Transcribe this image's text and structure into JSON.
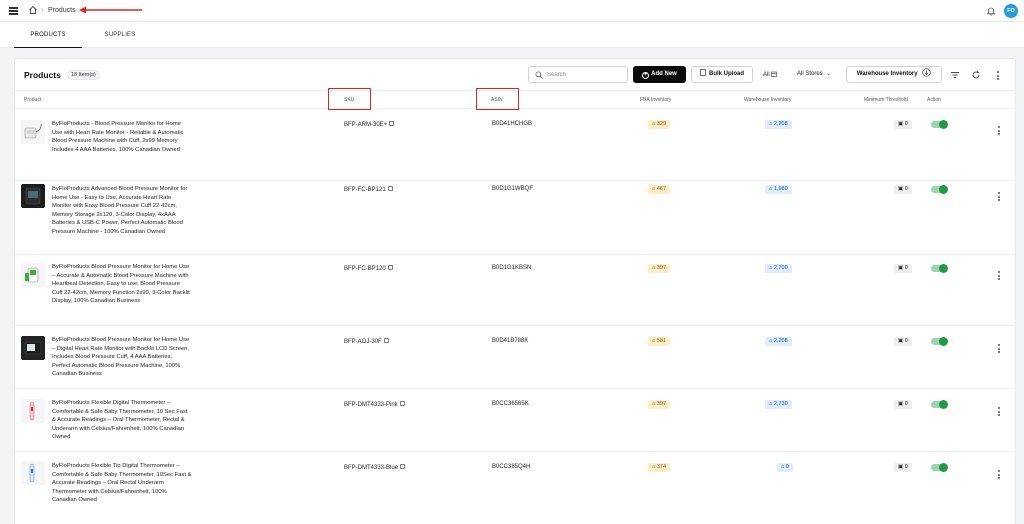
{
  "breadcrumb": {
    "current": "Products"
  },
  "user": {
    "initials": "FO"
  },
  "tabs": [
    {
      "label": "PRODUCTS"
    },
    {
      "label": "SUPPLIES"
    }
  ],
  "toolbar": {
    "title": "Products",
    "count": "18 Item(s)",
    "search_placeholder": "Search",
    "add_label": "Add New",
    "bulk_label": "Bulk Upload",
    "all_filter": "All",
    "stores_filter": "All Stores",
    "warehouse_filter": "Warehouse Inventory"
  },
  "columns": {
    "product": "Product",
    "sku": "SKU",
    "asin": "ASIN",
    "fba": "FBA Inventory",
    "warehouse": "Warehouse Inventory",
    "min": "Minimum Threshold",
    "action": "Action"
  },
  "rows": [
    {
      "name": "ByFloProducts - Blood Pressure Monitor for Home Use with Heart Rate Monitor - Reliable & Automatic Blood Pressure Machine with Cuff, 2x99 Memory Includes 4 AAA Batteries, 100% Canadian Owned",
      "sku": "BFP-ARM-30E+",
      "asin": "B0D41HCHGB",
      "fba": "329",
      "warehouse": "2,208",
      "min": "0",
      "active": true
    },
    {
      "name": "ByFloProducts Advanced Blood Pressure Monitor for Home Use - Easy to Use, Accurate Heart Rate Monitor with Easy Blood Pressure Cuff 22-42cm, Memory Storage 2x120, 3-Color Display, 4xAAA Batteries & USB-C Power, Perfect Automatic Blood Pressure Machine - 100% Canadian Owned",
      "sku": "BFP-FC-BP121",
      "asin": "B0D1G1WBQF",
      "fba": "467",
      "warehouse": "1,980",
      "min": "0",
      "active": true
    },
    {
      "name": "ByFloProducts Blood Pressure Monitor for Home Use – Accurate & Automatic Blood Pressure Machine with Heartbeat Detection, Easy to use, Blood Pressure Cuff 22-42cm, Memory Function 2x99, 3-Color Backlit Display, 100% Canadian Business",
      "sku": "BFP-FC-BP120",
      "asin": "B0D1G1KBSN",
      "fba": "397",
      "warehouse": "2,700",
      "min": "0",
      "active": true
    },
    {
      "name": "ByFloProducts Blood Pressure Monitor for Home Use – Digital Heart Rate Monitor with Backlit LCD Screen, Includes Blood Pressure Cuff, 4 AAA Batteries, Perfect Automatic Blood Pressure Machine, 100% Canadian Business",
      "sku": "BFP-AOJ-30F",
      "asin": "B0D41B788K",
      "fba": "581",
      "warehouse": "2,208",
      "min": "0",
      "active": true
    },
    {
      "name": "ByFloProducts Flexible Digital Thermometer – Comfortable & Safe Baby Thermometer, 10 Sec Fast & Accurate Readings – Oral Thermometer, Rectal & Underarm with Celsius/Fahrenheit, 100% Canadian Owned",
      "sku": "BFP-DMT4333-Pink",
      "asin": "B0CC36565K",
      "fba": "397",
      "warehouse": "2,730",
      "min": "0",
      "active": true
    },
    {
      "name": "ByFloProducts Flexible Tip Digital Thermometer – Comfortable & Safe Baby Thermometer, 10Sec Fast & Accurate Readings – Oral Rectal Underarm Thermometer with Celsius/Fahrenheit, 100% Canadian Owned",
      "sku": "BFP-DMT4333-Blue",
      "asin": "B0CC385Q4H",
      "fba": "374",
      "warehouse": "0",
      "min": "0",
      "active": true
    }
  ]
}
